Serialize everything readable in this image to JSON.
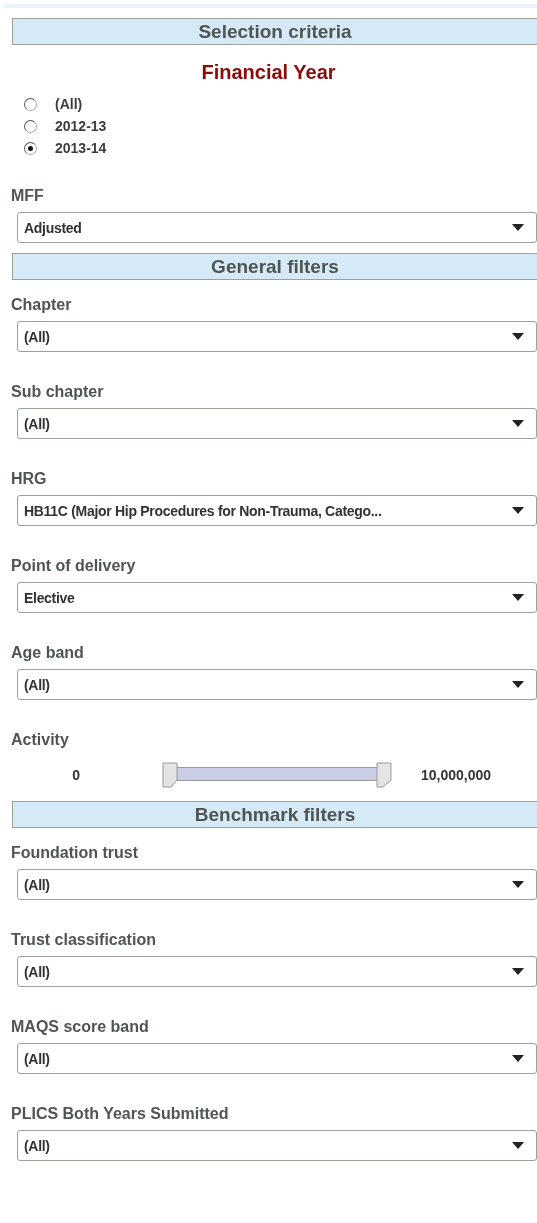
{
  "sections": [
    {
      "title": "Selection criteria",
      "items": [
        {
          "kind": "radio_group",
          "title": "Financial Year",
          "options": [
            {
              "label": "(All)",
              "selected": false
            },
            {
              "label": "2012-13",
              "selected": false
            },
            {
              "label": "2013-14",
              "selected": true
            }
          ]
        },
        {
          "kind": "dropdown",
          "label": "MFF",
          "value": "Adjusted"
        }
      ]
    },
    {
      "title": "General filters",
      "items": [
        {
          "kind": "dropdown",
          "label": "Chapter",
          "value": "(All)"
        },
        {
          "kind": "dropdown",
          "label": "Sub chapter",
          "value": "(All)"
        },
        {
          "kind": "dropdown",
          "label": "HRG",
          "value": "HB11C (Major Hip Procedures for Non-Trauma, Catego..."
        },
        {
          "kind": "dropdown",
          "label": "Point of delivery",
          "value": "Elective"
        },
        {
          "kind": "dropdown",
          "label": "Age band",
          "value": "(All)"
        },
        {
          "kind": "range",
          "label": "Activity",
          "min_label": "0",
          "max_label": "10,000,000",
          "start": {
            "level": 0
          },
          "end": {
            "level": 1
          }
        }
      ]
    },
    {
      "title": "Benchmark filters",
      "items": [
        {
          "kind": "dropdown",
          "label": "Foundation trust",
          "value": "(All)"
        },
        {
          "kind": "dropdown",
          "label": "Trust classification",
          "value": "(All)"
        },
        {
          "kind": "dropdown",
          "label": "MAQS score band",
          "value": "(All)"
        },
        {
          "kind": "dropdown",
          "label": "PLICS Both Years Submitted",
          "value": "(All)"
        }
      ]
    }
  ]
}
